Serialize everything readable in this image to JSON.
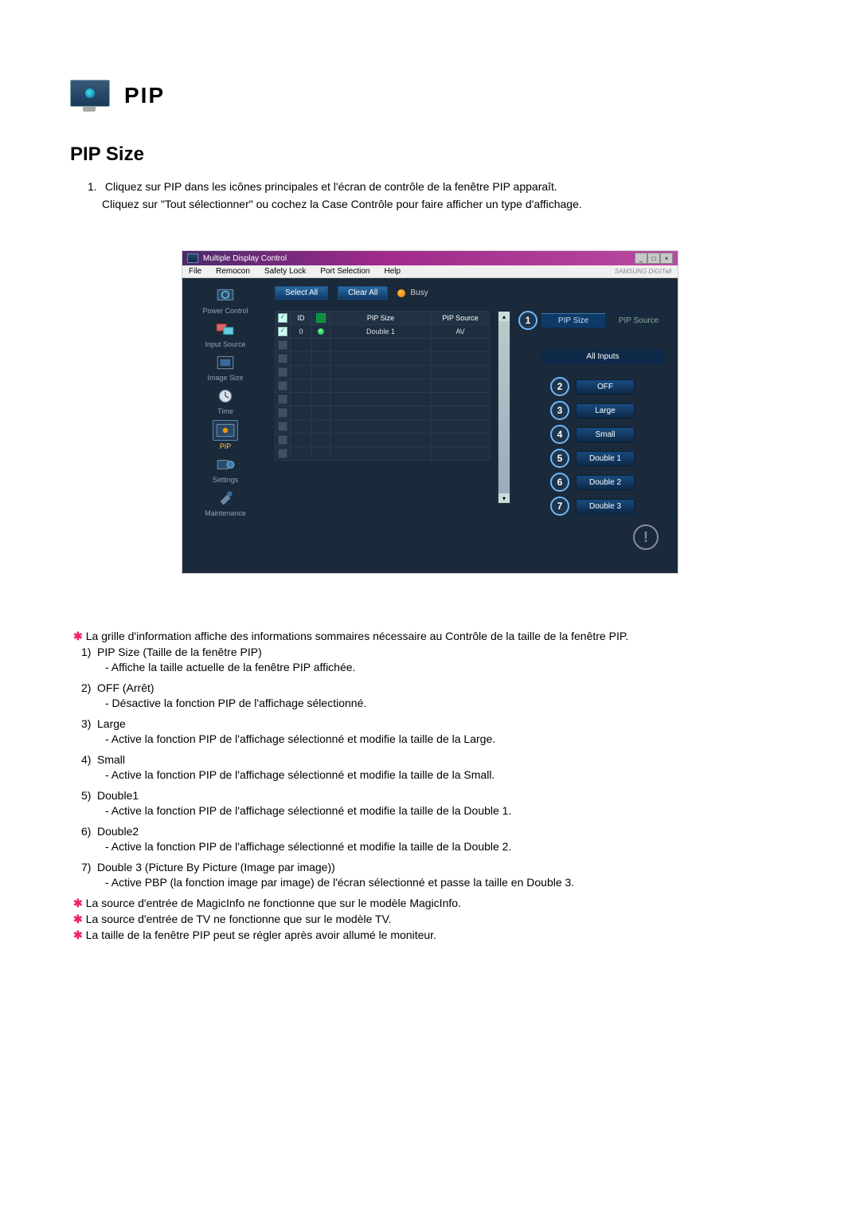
{
  "title_icon_label": "PIP",
  "section_title": "PIP Size",
  "intro_num": "1.",
  "intro_line1": "Cliquez sur PIP dans les icônes principales et l'écran de contrôle de la fenêtre PIP apparaît.",
  "intro_line2": "Cliquez sur \"Tout sélectionner\" ou cochez la Case Contrôle pour faire afficher un type d'affichage.",
  "app": {
    "title": "Multiple Display Control",
    "menu": [
      "File",
      "Remocon",
      "Safety Lock",
      "Port Selection",
      "Help"
    ],
    "brand": "SAMSUNG DIGITall",
    "sidebar": [
      {
        "label": "Power Control"
      },
      {
        "label": "Input Source"
      },
      {
        "label": "Image Size"
      },
      {
        "label": "Time"
      },
      {
        "label": "PIP",
        "selected": true
      },
      {
        "label": "Settings"
      },
      {
        "label": "Maintenance"
      }
    ],
    "toolbar": {
      "select_all": "Select All",
      "clear_all": "Clear All",
      "busy": "Busy"
    },
    "grid": {
      "headers": {
        "chk": "☑",
        "id": "ID",
        "status": "",
        "pip": "PIP Size",
        "src": "PIP Source"
      },
      "rows": [
        {
          "checked": true,
          "id": "0",
          "dot": true,
          "pip": "Double 1",
          "src": "AV"
        },
        {
          "checked": false
        },
        {
          "checked": false
        },
        {
          "checked": false
        },
        {
          "checked": false
        },
        {
          "checked": false
        },
        {
          "checked": false
        },
        {
          "checked": false
        },
        {
          "checked": false
        },
        {
          "checked": false
        }
      ]
    },
    "tabs": {
      "left": "PIP Size",
      "right": "PIP Source"
    },
    "all_inputs": "All Inputs",
    "options": [
      {
        "n": "2",
        "label": "OFF"
      },
      {
        "n": "3",
        "label": "Large"
      },
      {
        "n": "4",
        "label": "Small"
      },
      {
        "n": "5",
        "label": "Double 1"
      },
      {
        "n": "6",
        "label": "Double 2"
      },
      {
        "n": "7",
        "label": "Double 3"
      }
    ],
    "marker1": "1"
  },
  "notes": {
    "star1": "La grille d'information affiche des informations sommaires nécessaire au Contrôle de la taille de la fenêtre PIP.",
    "items": [
      {
        "n": "1)",
        "title": "PIP Size (Taille de la fenêtre PIP)",
        "sub": "- Affiche la taille actuelle de la fenêtre PIP affichée."
      },
      {
        "n": "2)",
        "title": "OFF (Arrêt)",
        "sub": "- Désactive la fonction PIP de l'affichage sélectionné."
      },
      {
        "n": "3)",
        "title": "Large",
        "sub": "- Active la fonction PIP de l'affichage sélectionné et modifie la taille de la Large."
      },
      {
        "n": "4)",
        "title": "Small",
        "sub": "- Active la fonction PIP de l'affichage sélectionné et modifie la taille de la Small."
      },
      {
        "n": "5)",
        "title": "Double1",
        "sub": "- Active la fonction PIP de l'affichage sélectionné et modifie la taille de la Double 1."
      },
      {
        "n": "6)",
        "title": "Double2",
        "sub": "- Active la fonction PIP de l'affichage sélectionné et modifie la taille de la Double 2."
      },
      {
        "n": "7)",
        "title": "Double 3 (Picture By Picture (Image par image))",
        "sub": "- Active PBP (la fonction image par image) de l'écran sélectionné et passe la taille en Double 3."
      }
    ],
    "star2": "La source d'entrée de MagicInfo ne fonctionne que sur le modèle MagicInfo.",
    "star3": "La source d'entrée de TV ne fonctionne que sur le modèle TV.",
    "star4": "La taille de la fenêtre PIP peut se régler après avoir allumé le moniteur."
  }
}
